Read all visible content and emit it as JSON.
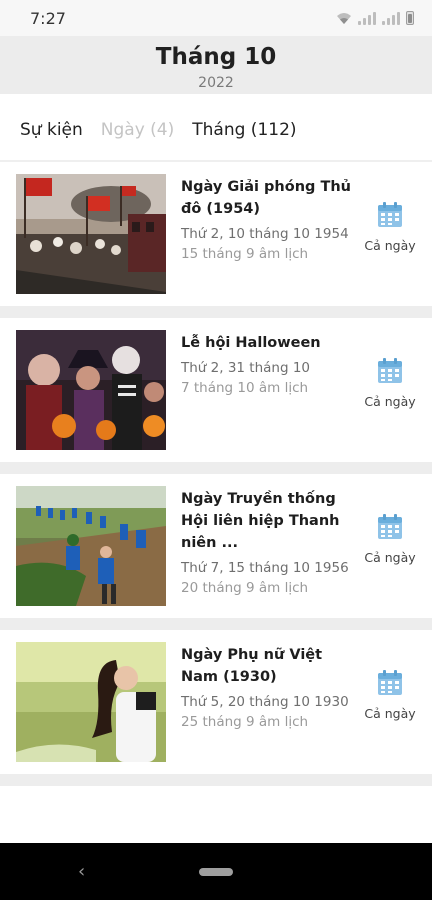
{
  "status_bar": {
    "time": "7:27"
  },
  "header": {
    "month": "Tháng 10",
    "year": "2022"
  },
  "tabs": [
    {
      "label": "Sự kiện",
      "state": "normal"
    },
    {
      "label": "Ngày (4)",
      "state": "dimmed"
    },
    {
      "label": "Tháng (112)",
      "state": "normal"
    }
  ],
  "events": [
    {
      "title": "Ngày Giải phóng Thủ đô (1954)",
      "date": "Thứ 2, 10 tháng 10 1954",
      "lunar": "15 tháng 9 âm lịch",
      "all_day": "Cả ngày"
    },
    {
      "title": "Lễ hội Halloween",
      "date": "Thứ 2, 31 tháng 10",
      "lunar": "7 tháng 10 âm lịch",
      "all_day": "Cả ngày"
    },
    {
      "title": "Ngày Truyền thống Hội liên hiệp Thanh niên ...",
      "date": "Thứ 7, 15 tháng 10 1956",
      "lunar": "20 tháng 9 âm lịch",
      "all_day": "Cả ngày"
    },
    {
      "title": "Ngày Phụ nữ Việt Nam (1930)",
      "date": "Thứ 5, 20 tháng 10 1930",
      "lunar": "25 tháng 9 âm lịch",
      "all_day": "Cả ngày"
    }
  ],
  "colors": {
    "calendar_icon": "#7fb8e0",
    "header_bg": "#ececec",
    "separator": "#ededed"
  }
}
